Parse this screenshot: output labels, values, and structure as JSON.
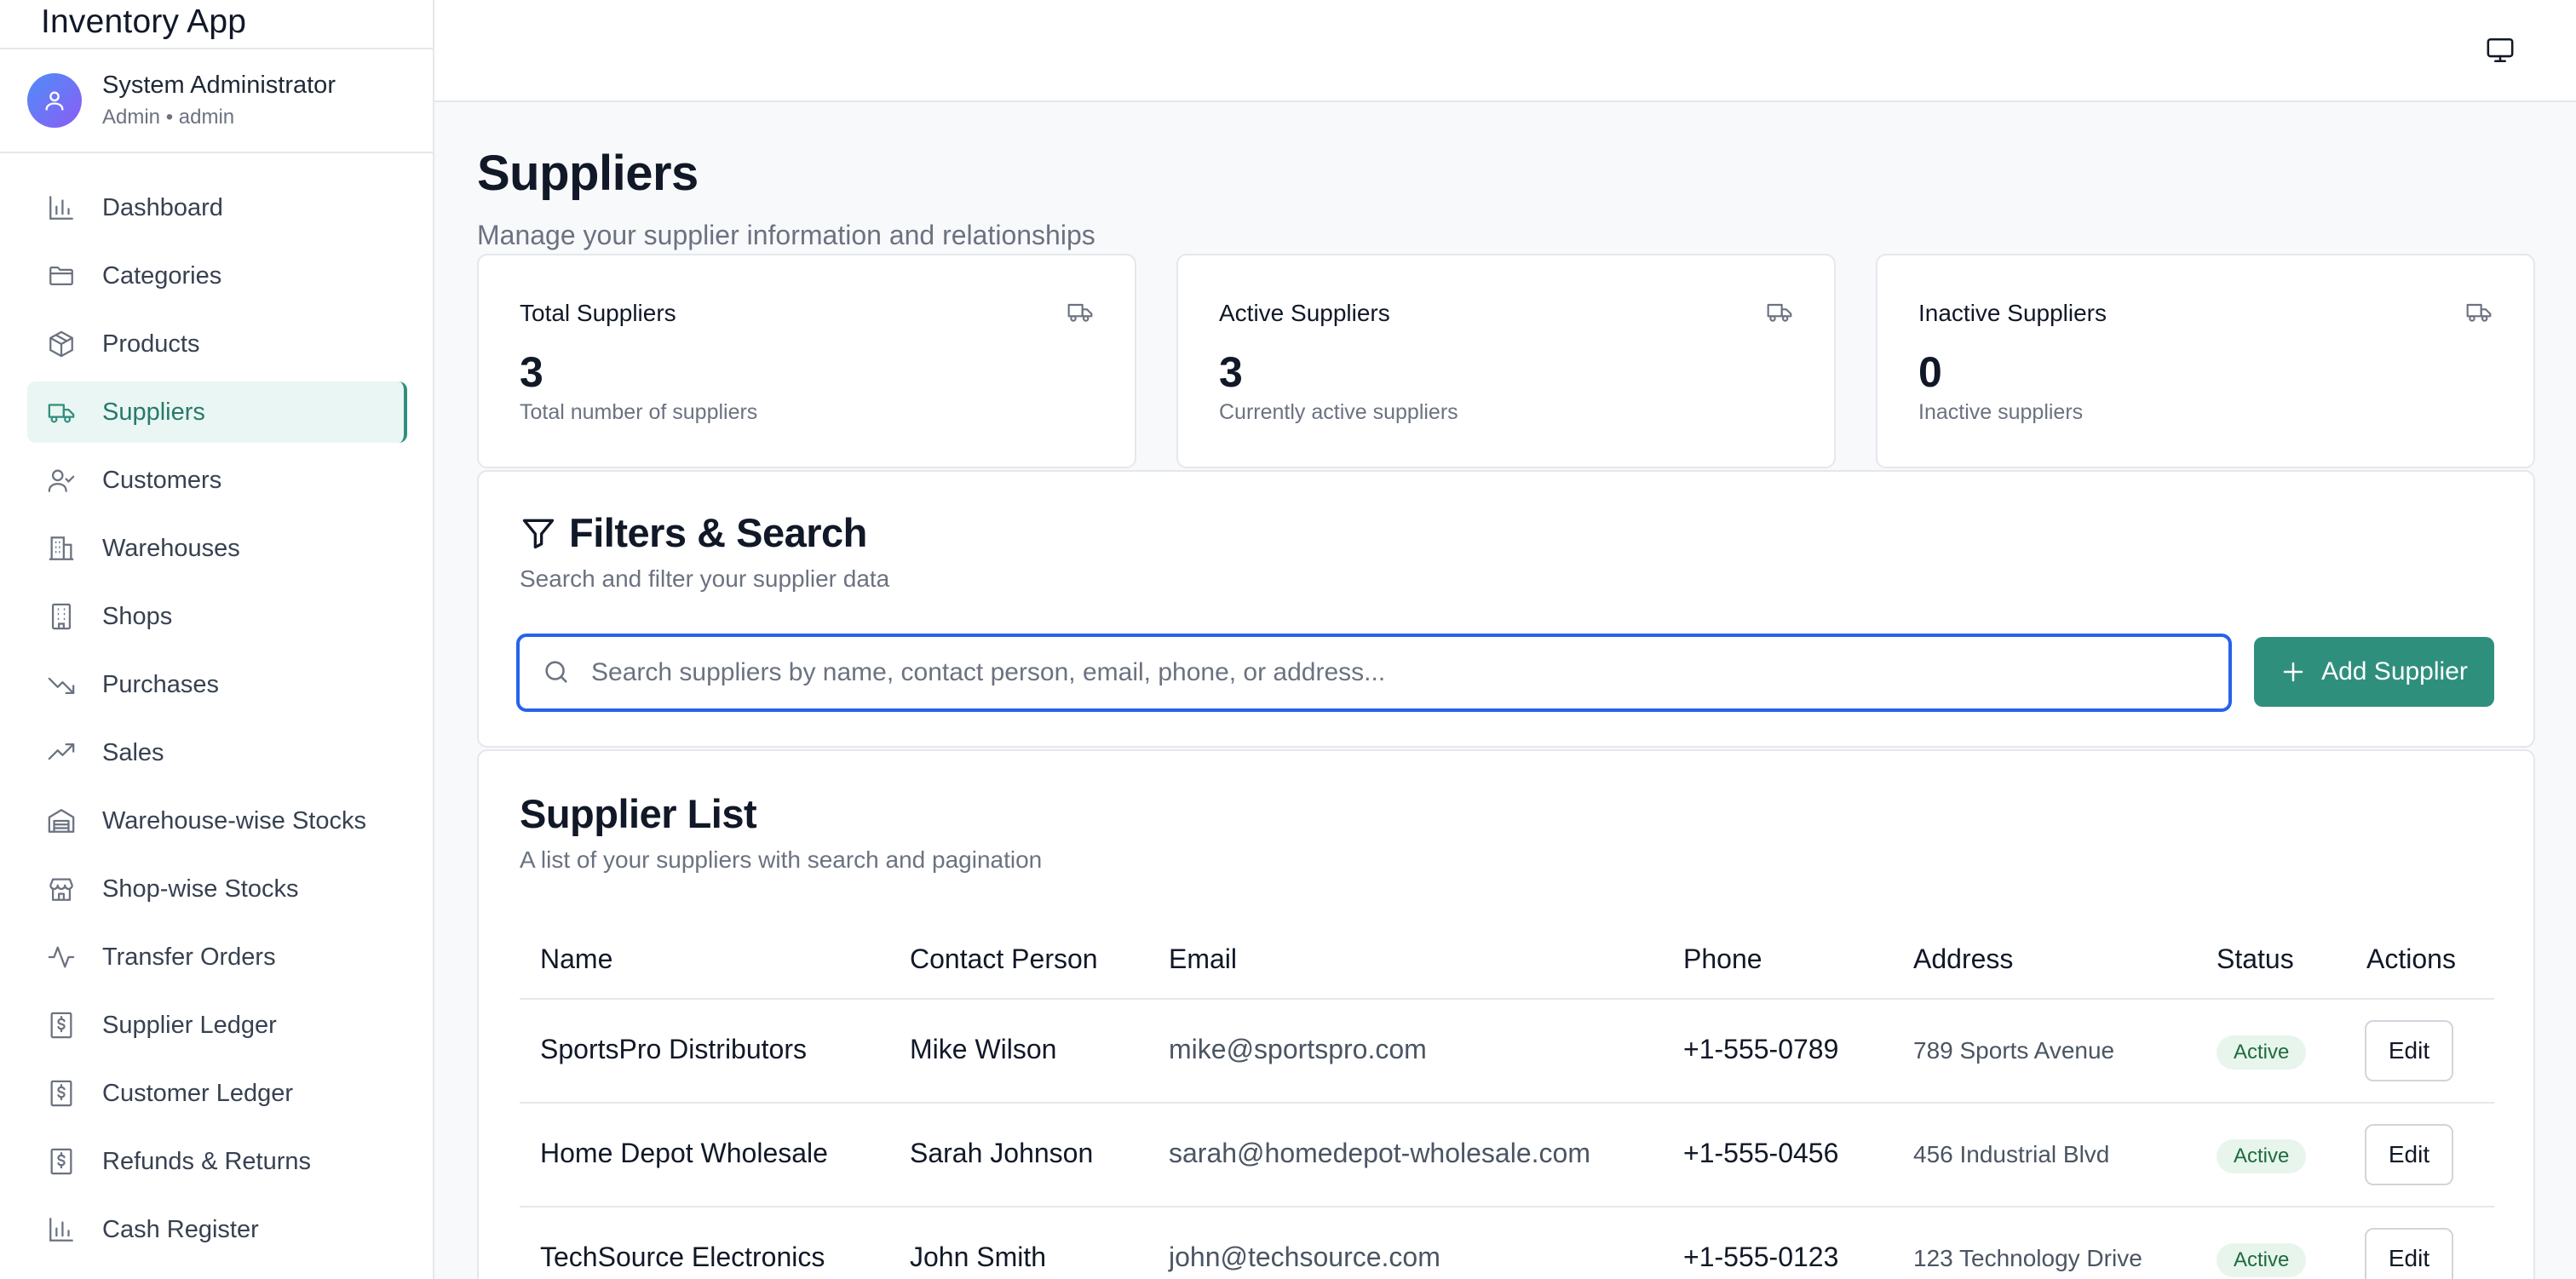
{
  "app": {
    "title": "Inventory App"
  },
  "user": {
    "name": "System Administrator",
    "role": "Admin • admin"
  },
  "sidebar": {
    "items": [
      {
        "label": "Dashboard",
        "icon": "bar-chart-icon"
      },
      {
        "label": "Categories",
        "icon": "folder-icon"
      },
      {
        "label": "Products",
        "icon": "package-icon"
      },
      {
        "label": "Suppliers",
        "icon": "truck-icon",
        "active": true
      },
      {
        "label": "Customers",
        "icon": "user-check-icon"
      },
      {
        "label": "Warehouses",
        "icon": "building-icon"
      },
      {
        "label": "Shops",
        "icon": "office-building-icon"
      },
      {
        "label": "Purchases",
        "icon": "trending-down-icon"
      },
      {
        "label": "Sales",
        "icon": "trending-up-icon"
      },
      {
        "label": "Warehouse-wise Stocks",
        "icon": "warehouse-icon"
      },
      {
        "label": "Shop-wise Stocks",
        "icon": "store-icon"
      },
      {
        "label": "Transfer Orders",
        "icon": "activity-icon"
      },
      {
        "label": "Supplier Ledger",
        "icon": "dollar-receipt-icon"
      },
      {
        "label": "Customer Ledger",
        "icon": "dollar-receipt-icon"
      },
      {
        "label": "Refunds & Returns",
        "icon": "dollar-receipt-icon"
      },
      {
        "label": "Cash Register",
        "icon": "bar-chart-icon"
      }
    ]
  },
  "topbar": {
    "icon": "monitor-icon"
  },
  "page": {
    "title": "Suppliers",
    "subtitle": "Manage your supplier information and relationships"
  },
  "stats": [
    {
      "label": "Total Suppliers",
      "value": "3",
      "desc": "Total number of suppliers",
      "icon": "truck-icon"
    },
    {
      "label": "Active Suppliers",
      "value": "3",
      "desc": "Currently active suppliers",
      "icon": "truck-icon"
    },
    {
      "label": "Inactive Suppliers",
      "value": "0",
      "desc": "Inactive suppliers",
      "icon": "truck-icon"
    }
  ],
  "filters": {
    "title": "Filters & Search",
    "desc": "Search and filter your supplier data",
    "search_placeholder": "Search suppliers by name, contact person, email, phone, or address...",
    "search_value": "",
    "add_label": "Add Supplier"
  },
  "list": {
    "title": "Supplier List",
    "desc": "A list of your suppliers with search and pagination",
    "columns": [
      "Name",
      "Contact Person",
      "Email",
      "Phone",
      "Address",
      "Status",
      "Actions"
    ],
    "rows": [
      {
        "name": "SportsPro Distributors",
        "contact": "Mike Wilson",
        "email": "mike@sportspro.com",
        "phone": "+1-555-0789",
        "address": "789 Sports Avenue",
        "status": "Active",
        "action": "Edit"
      },
      {
        "name": "Home Depot Wholesale",
        "contact": "Sarah Johnson",
        "email": "sarah@homedepot-wholesale.com",
        "phone": "+1-555-0456",
        "address": "456 Industrial Blvd",
        "status": "Active",
        "action": "Edit"
      },
      {
        "name": "TechSource Electronics",
        "contact": "John Smith",
        "email": "john@techsource.com",
        "phone": "+1-555-0123",
        "address": "123 Technology Drive",
        "status": "Active",
        "action": "Edit"
      }
    ]
  },
  "colors": {
    "accent": "#2f8f7d",
    "focus": "#2563eb",
    "active_bg": "#eaf6f3",
    "badge_bg": "#e7f5ec",
    "badge_text": "#1f6b3e"
  }
}
